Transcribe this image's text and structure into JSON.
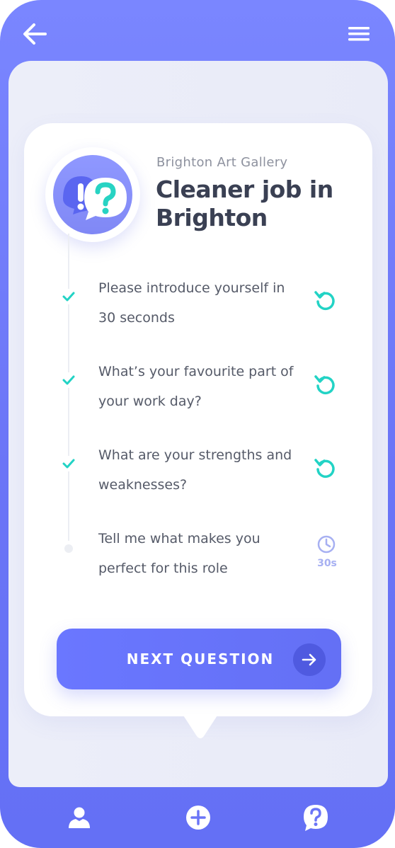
{
  "header": {
    "back_icon": "arrow-left-icon",
    "menu_icon": "hamburger-menu-icon"
  },
  "job": {
    "employer": "Brighton Art Gallery",
    "title": "Cleaner job in Brighton",
    "badge_icon": "question-exclamation-chat-icon"
  },
  "questions": [
    {
      "text": "Please introduce yourself in 30 seconds",
      "status": "completed",
      "status_icon": "check-icon",
      "action_icon": "retry-icon"
    },
    {
      "text": "What’s your favourite part of your work day?",
      "status": "completed",
      "status_icon": "check-icon",
      "action_icon": "retry-icon"
    },
    {
      "text": "What are your strengths and weaknesses?",
      "status": "completed",
      "status_icon": "check-icon",
      "action_icon": "retry-icon"
    },
    {
      "text": "Tell me what makes you perfect for this role",
      "status": "pending",
      "status_icon": "dot-icon",
      "action_icon": "clock-icon",
      "time_label": "30s"
    }
  ],
  "next_button": {
    "label": "NEXT QUESTION",
    "icon": "arrow-right-icon"
  },
  "bottom_nav": [
    {
      "icon": "profile-icon"
    },
    {
      "icon": "add-circle-icon"
    },
    {
      "icon": "help-chat-icon"
    }
  ],
  "colors": {
    "primary": "#6b75f7",
    "accent_teal": "#22d3c5",
    "text_dark": "#3a4053",
    "text_muted": "#8d919e",
    "timer": "#a7b0f2"
  }
}
